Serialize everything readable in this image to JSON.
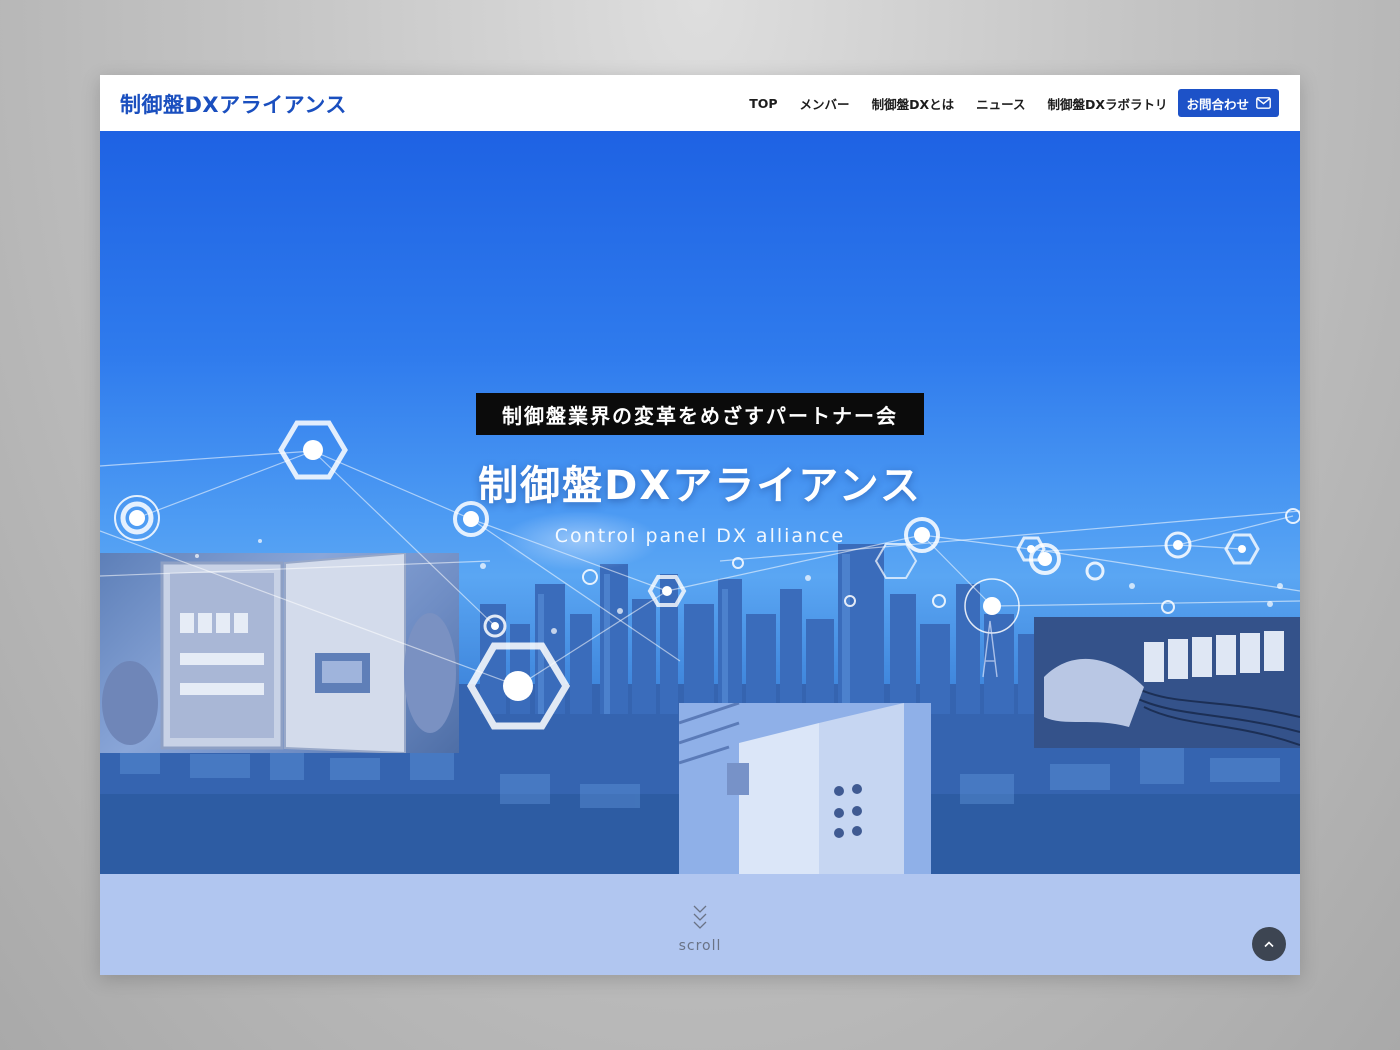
{
  "header": {
    "logo": "制御盤DXアライアンス",
    "nav": [
      "TOP",
      "メンバー",
      "制御盤DXとは",
      "ニュース",
      "制御盤DXラボラトリ"
    ],
    "contact_label": "お問合わせ",
    "contact_icon": "mail-icon"
  },
  "hero": {
    "tagline": "制御盤業界の変革をめざすパートナー会",
    "title": "制御盤DXアライアンス",
    "subtitle": "Control panel DX alliance"
  },
  "scroll": {
    "label": "scroll",
    "icon": "chevrons-down-icon"
  },
  "to_top": {
    "icon": "chevron-up-icon"
  },
  "colors": {
    "brand": "#1a4fbf",
    "button": "#1d52c8",
    "scroll_band": "#b1c6f0",
    "to_top": "#3d4552"
  }
}
